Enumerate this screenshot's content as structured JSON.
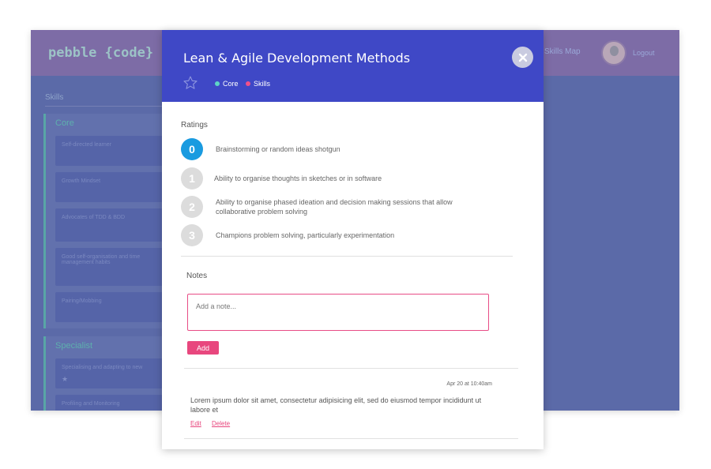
{
  "background_app": {
    "logo": "pebble {code}",
    "nav_link": "Skills Map",
    "user_link": "Logout",
    "skills_label": "Skills",
    "groups": [
      {
        "title": "Core",
        "cards": [
          "Self-directed learner",
          "Growth Mindset",
          "Advocates of TDD & BDD",
          "Good self-organisation and time management habits",
          "Pairing/Mobbing"
        ]
      },
      {
        "title": "Specialist",
        "cards": [
          "Specialising and adapting to new",
          "Profiling and Monitoring"
        ]
      }
    ]
  },
  "modal": {
    "title": "Lean & Agile Development Methods",
    "tags": [
      {
        "label": "Core",
        "color": "#5ed4c6"
      },
      {
        "label": "Skills",
        "color": "#f0508a"
      }
    ],
    "ratings_label": "Ratings",
    "ratings": [
      {
        "level": "0",
        "text": "Brainstorming or random ideas shotgun",
        "active": true
      },
      {
        "level": "1",
        "text": "Ability to organise thoughts in sketches or in software",
        "active": false
      },
      {
        "level": "2",
        "text": "Ability to organise phased ideation and decision making sessions that allow collaborative problem solving",
        "active": false
      },
      {
        "level": "3",
        "text": "Champions problem solving, particularly experimentation",
        "active": false
      }
    ],
    "notes_label": "Notes",
    "note_placeholder": "Add a note...",
    "add_label": "Add",
    "notes": [
      {
        "timestamp": "Apr 20 at 10:40am",
        "body": "Lorem ipsum dolor sit amet, consectetur adipisicing elit, sed do eiusmod tempor incididunt ut labore et",
        "edit_label": "Edit",
        "delete_label": "Delete"
      }
    ]
  },
  "colors": {
    "header": "#3f48c6",
    "active_rating": "#1a9be0",
    "accent_pink": "#e8477e"
  }
}
